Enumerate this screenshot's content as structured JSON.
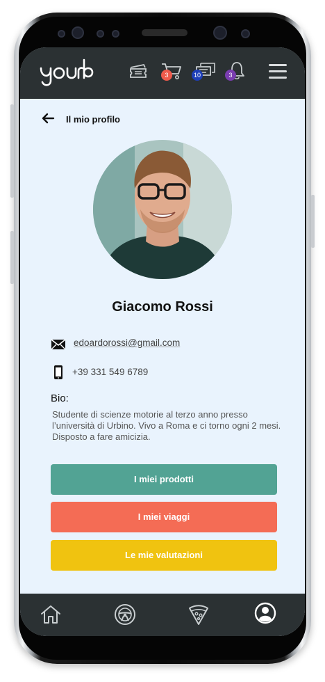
{
  "topbar": {
    "logo_text": "yourb",
    "badges": {
      "cart": "3",
      "messages": "10",
      "notifications": "3"
    },
    "icons": [
      "ticket-icon",
      "cart-icon",
      "messages-icon",
      "bell-icon",
      "menu-icon"
    ]
  },
  "header": {
    "title": "Il mio profilo"
  },
  "profile": {
    "name": "Giacomo Rossi",
    "email": "edoardorossi@gmail.com",
    "phone": "+39 331 549 6789",
    "bio_label": "Bio:",
    "bio": "Studente di scienze motorie al terzo anno presso l’università di Urbino. Vivo a Roma e ci torno ogni 2 mesi. Disposto a fare amicizia."
  },
  "buttons": {
    "products": "I miei prodotti",
    "trips": "I miei viaggi",
    "ratings": "Le mie valutazioni"
  },
  "bottom_nav": [
    "home-icon",
    "steering-wheel-icon",
    "pizza-icon",
    "profile-icon"
  ],
  "colors": {
    "bar": "#2b3133",
    "screen_bg": "#e9f3fd",
    "products": "#52a394",
    "trips": "#f46c55",
    "ratings": "#f0c310",
    "badge_cart": "#ef5b4c",
    "badge_messages": "#1e3fb8",
    "badge_notifications": "#7a3db0"
  }
}
